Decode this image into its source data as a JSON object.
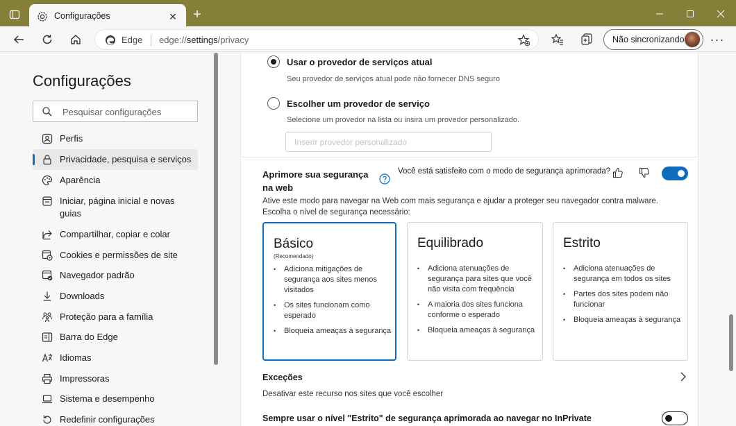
{
  "window": {
    "tab_title": "Configurações",
    "tab_icon": "gear-icon"
  },
  "toolbar": {
    "edge_label": "Edge",
    "url_prefix": "edge://",
    "url_bold": "settings",
    "url_suffix": "/privacy",
    "sync_label": "Não sincronizando"
  },
  "sidebar": {
    "title": "Configurações",
    "search_placeholder": "Pesquisar configurações",
    "items": [
      {
        "label": "Perfis",
        "icon": "profile-icon"
      },
      {
        "label": "Privacidade, pesquisa e serviços",
        "icon": "lock-icon",
        "active": true
      },
      {
        "label": "Aparência",
        "icon": "palette-icon"
      },
      {
        "label": "Iniciar, página inicial e novas guias",
        "icon": "home-page-icon"
      },
      {
        "label": "Compartilhar, copiar e colar",
        "icon": "share-icon"
      },
      {
        "label": "Cookies e permissões de site",
        "icon": "cookies-icon"
      },
      {
        "label": "Navegador padrão",
        "icon": "browser-icon"
      },
      {
        "label": "Downloads",
        "icon": "download-icon"
      },
      {
        "label": "Proteção para a família",
        "icon": "family-icon"
      },
      {
        "label": "Barra do Edge",
        "icon": "edge-bar-icon"
      },
      {
        "label": "Idiomas",
        "icon": "languages-icon"
      },
      {
        "label": "Impressoras",
        "icon": "printer-icon"
      },
      {
        "label": "Sistema e desempenho",
        "icon": "laptop-icon"
      },
      {
        "label": "Redefinir configurações",
        "icon": "reset-icon"
      }
    ]
  },
  "dns": {
    "option1_label": "Usar o provedor de serviços atual",
    "option1_sub": "Seu provedor de serviços atual pode não fornecer DNS seguro",
    "option2_label": "Escolher um provedor de serviço",
    "option2_sub": "Selecione um provedor na lista ou insira um provedor personalizado.",
    "custom_placeholder": "Inserir provedor personalizado"
  },
  "security": {
    "title": "Aprimore sua segurança na web",
    "feedback_question": "Você está satisfeito com o modo de segurança aprimorada?",
    "enabled": true,
    "description": "Ative este modo para navegar na Web com mais segurança e ajudar a proteger seu navegador contra malware. Escolha o nível de segurança necessário:",
    "cards": [
      {
        "title": "Básico",
        "badge": "(Recomendado)",
        "selected": true,
        "bullets": [
          "Adiciona mitigações de segurança aos sites menos visitados",
          "Os sites funcionam como esperado",
          "Bloqueia ameaças à segurança"
        ]
      },
      {
        "title": "Equilibrado",
        "badge": "",
        "selected": false,
        "bullets": [
          "Adiciona atenuações de segurança para sites que você não visita com frequência",
          "A maioria dos sites funciona conforme o esperado",
          "Bloqueia ameaças à segurança"
        ]
      },
      {
        "title": "Estrito",
        "badge": "",
        "selected": false,
        "bullets": [
          "Adiciona atenuações de segurança em todos os sites",
          "Partes dos sites podem não funcionar",
          "Bloqueia ameaças à segurança"
        ]
      }
    ],
    "exceptions_title": "Exceções",
    "exceptions_sub": "Desativar este recurso nos sites que você escolher",
    "inprivate_label": "Sempre usar o nível \"Estrito\" de segurança aprimorada ao navegar no InPrivate",
    "inprivate_enabled": false
  },
  "colors": {
    "titlebar": "#857f39",
    "accent": "#0f6cbd"
  }
}
